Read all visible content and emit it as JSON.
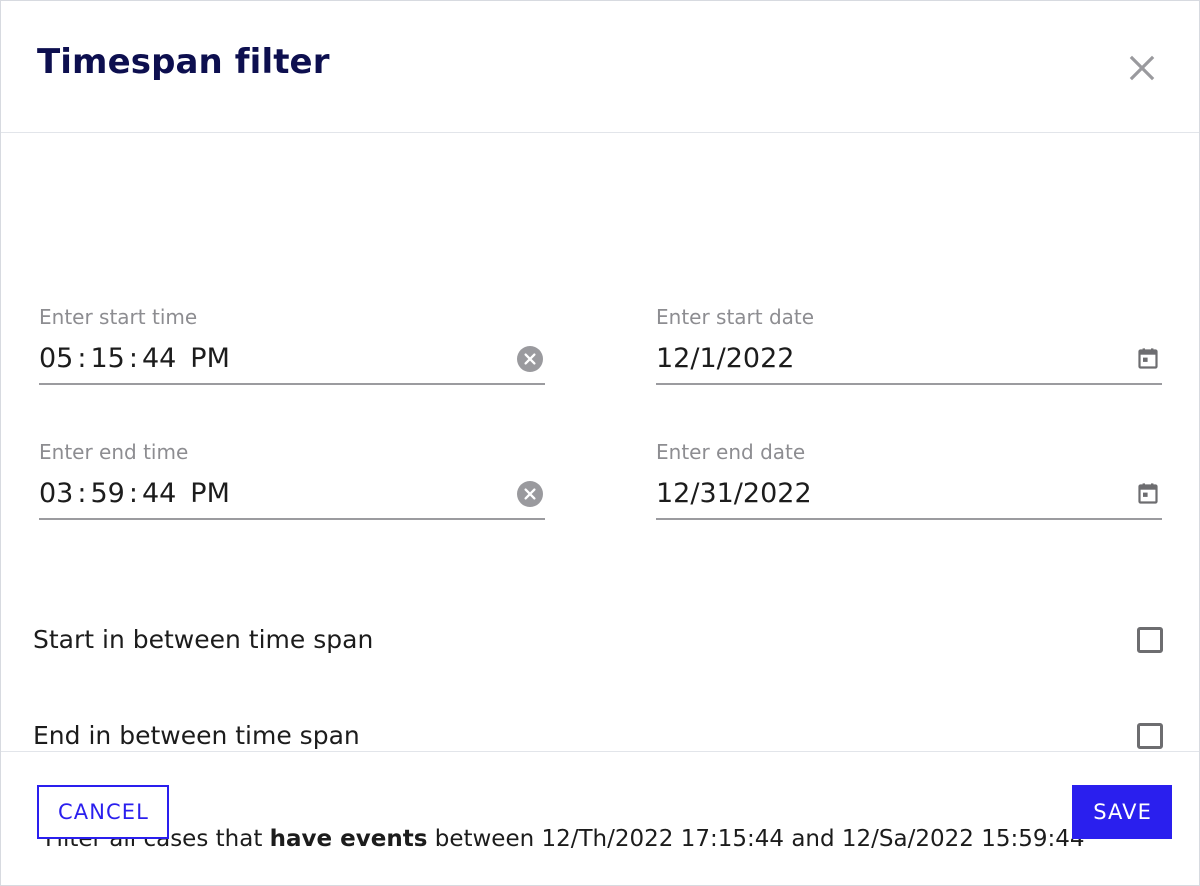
{
  "dialog": {
    "title": "Timespan filter",
    "close_icon": "close-icon"
  },
  "fields": {
    "start_time": {
      "label": "Enter start time",
      "hours": "05",
      "minutes": "15",
      "seconds": "44",
      "meridiem": "PM",
      "colon": ":",
      "value": "05:15:44 PM",
      "trailing_icon": "clear-circle-icon"
    },
    "end_time": {
      "label": "Enter end time",
      "hours": "03",
      "minutes": "59",
      "seconds": "44",
      "meridiem": "PM",
      "colon": ":",
      "value": "03:59:44 PM",
      "trailing_icon": "clear-circle-icon"
    },
    "start_date": {
      "label": "Enter start date",
      "value": "12/1/2022",
      "trailing_icon": "calendar-icon"
    },
    "end_date": {
      "label": "Enter end date",
      "value": "12/31/2022",
      "trailing_icon": "calendar-icon"
    }
  },
  "checkboxes": [
    {
      "label": "Start in between time span",
      "checked": false
    },
    {
      "label": "End in between time span",
      "checked": false
    }
  ],
  "summary": {
    "prefix": "Filter all cases that ",
    "emphasis": "have events",
    "middle": " between 12/Th/2022 17:15:44 and 12/Sa/2022 15:59:44",
    "full_text": "Filter all cases that have events between 12/Th/2022 17:15:44 and 12/Sa/2022 15:59:44"
  },
  "footer": {
    "cancel_label": "CANCEL",
    "save_label": "SAVE"
  },
  "colors": {
    "title": "#0d0f4f",
    "accent": "#2a1fee",
    "label": "#8d8d91",
    "value": "#1c1c1c",
    "underline": "#9b9b9f",
    "divider": "#e2e5ea",
    "icon_gray": "#9a9a9e"
  }
}
